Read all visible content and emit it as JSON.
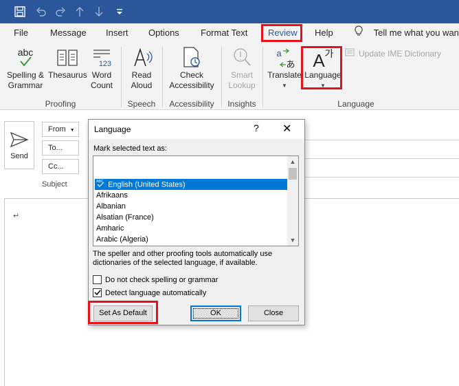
{
  "qat": {
    "save_icon": "save-icon",
    "undo_icon": "undo-icon",
    "redo_icon": "redo-icon",
    "up_icon": "arrow-up-icon",
    "down_icon": "arrow-down-icon",
    "customize_icon": "customize-qat-icon"
  },
  "tabs": [
    {
      "label": "File"
    },
    {
      "label": "Message"
    },
    {
      "label": "Insert"
    },
    {
      "label": "Options"
    },
    {
      "label": "Format Text"
    },
    {
      "label": "Review"
    },
    {
      "label": "Help"
    }
  ],
  "tell_me": "Tell me what you want",
  "ribbon": {
    "spelling": "Spelling & Grammar",
    "thesaurus": "Thesaurus",
    "word_count": "Word Count",
    "read_aloud": "Read Aloud",
    "check_accessibility": "Check Accessibility",
    "smart_lookup": "Smart Lookup",
    "translate": "Translate",
    "language": "Language",
    "update_ime": "Update IME Dictionary",
    "abc": "abc",
    "num_123": "123",
    "lang_glyph": "A",
    "lang_glyph2": "가",
    "groups": {
      "proofing": "Proofing",
      "speech": "Speech",
      "accessibility": "Accessibility",
      "insights": "Insights",
      "language": "Language"
    }
  },
  "compose": {
    "send": "Send",
    "from": "From",
    "to": "To...",
    "cc": "Cc...",
    "subject": "Subject",
    "paragraph_mark": "↵"
  },
  "dialog": {
    "title": "Language",
    "help": "?",
    "close": "✕",
    "mark_label": "Mark selected text as:",
    "languages": [
      "",
      "English (United States)",
      "Afrikaans",
      "Albanian",
      "Alsatian (France)",
      "Amharic",
      "Arabic (Algeria)"
    ],
    "selected_index": 1,
    "note": "The speller and other proofing tools automatically use dictionaries of the selected language, if available.",
    "no_check": "Do not check spelling or grammar",
    "no_check_checked": false,
    "detect": "Detect language automatically",
    "detect_checked": true,
    "set_default": "Set As Default",
    "ok": "OK",
    "cancel": "Close"
  },
  "colors": {
    "title_bar": "#2b579a",
    "highlight": "#e3121b",
    "selection": "#0078d7"
  }
}
